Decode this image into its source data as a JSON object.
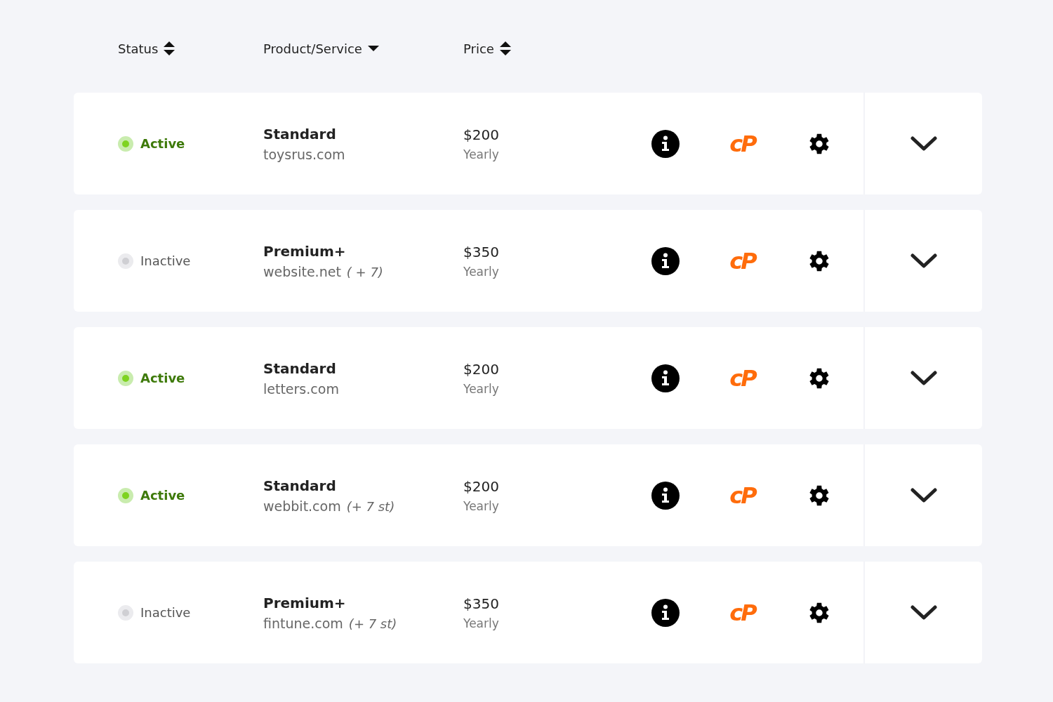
{
  "columns": [
    {
      "label": "Status",
      "kind": "sortable"
    },
    {
      "label": "Product/Service",
      "kind": "sorted"
    },
    {
      "label": "Price",
      "kind": "sortable"
    }
  ],
  "rows": [
    {
      "status": "Active",
      "active": true,
      "product": "Standard",
      "domain": "toysrus.com",
      "price": "$200",
      "cycle": "Yearly",
      "panel": "cP",
      "expanded": false
    },
    {
      "status": "Inactive",
      "active": false,
      "product": "Premium+",
      "domain": "website.net",
      "extra": "( + 7)",
      "price": "$350",
      "cycle": "Yearly",
      "panel": "cP",
      "expanded": false
    },
    {
      "status": "Active",
      "active": true,
      "product": "Standard",
      "domain": "letters.com",
      "price": "$200",
      "cycle": "Yearly",
      "panel": "cP",
      "expanded": false
    },
    {
      "status": "Active",
      "active": true,
      "product": "Standard",
      "domain": "webbit.com",
      "extra": "(+ 7 st)",
      "price": "$200",
      "cycle": "Yearly",
      "panel": "cP",
      "expanded": false
    },
    {
      "status": "Inactive",
      "active": false,
      "product": "Premium+",
      "domain": "fintune.com",
      "extra": "(+ 7 st)",
      "price": "$350",
      "cycle": "Yearly",
      "panel": "cP",
      "expanded": false
    }
  ]
}
